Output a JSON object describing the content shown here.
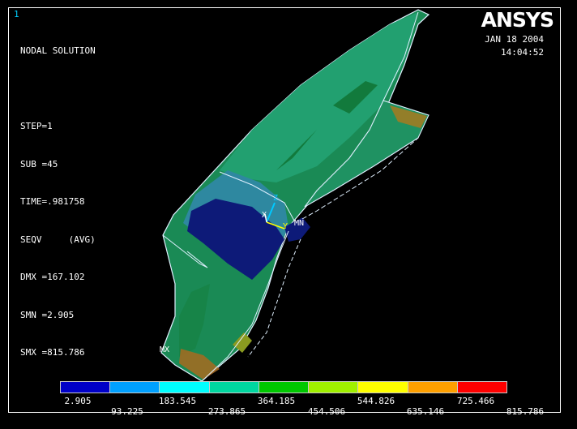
{
  "window_number": "1",
  "logo": "ANSYS",
  "info_lines": [
    "NODAL SOLUTION",
    "",
    "STEP=1",
    "SUB =45",
    "TIME=.981758",
    "SEQV     (AVG)",
    "DMX =167.102",
    "SMN =2.905",
    "SMX =815.786"
  ],
  "date": "JAN 18 2004",
  "time": "14:04:52",
  "triad": {
    "x": "X",
    "y": "Y",
    "z": "Z"
  },
  "markers": {
    "min": "MN",
    "max": "MX"
  },
  "legend": {
    "colors": [
      "#0000c8",
      "#00a0ff",
      "#00ffff",
      "#00d7a0",
      "#00c800",
      "#a0f000",
      "#ffff00",
      "#ffa000",
      "#ff0000"
    ],
    "lower_ticks": [
      "2.905",
      "183.545",
      "364.185",
      "544.826",
      "725.466"
    ],
    "upper_ticks": [
      "93.225",
      "273.865",
      "454.506",
      "635.146",
      "815.786"
    ]
  }
}
